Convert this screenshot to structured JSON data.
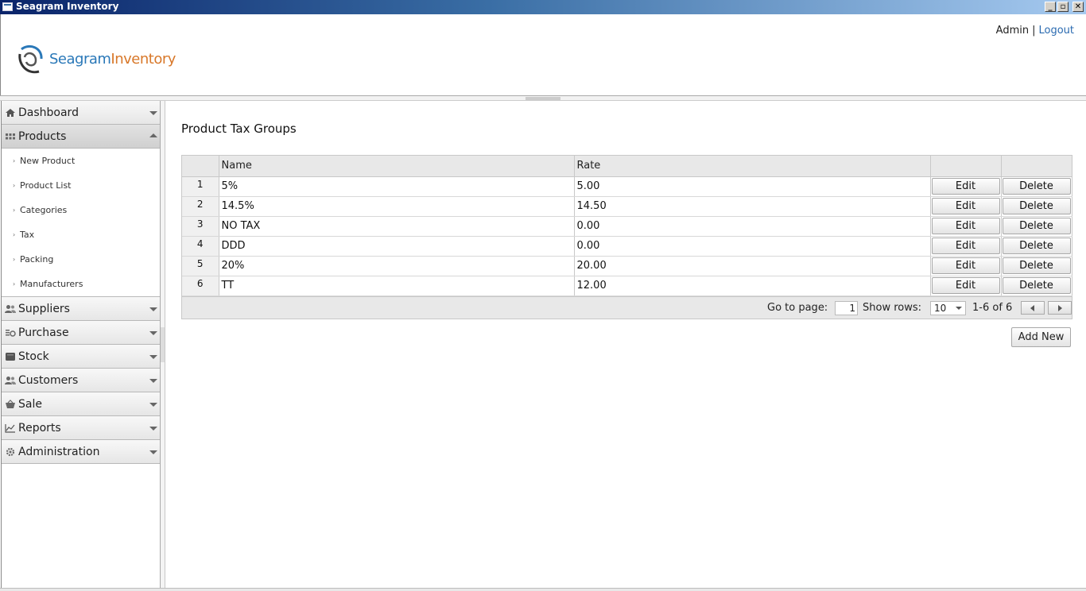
{
  "window": {
    "title": "Seagram Inventory",
    "buttons": [
      "minimize",
      "restore",
      "close"
    ]
  },
  "header": {
    "logo": {
      "part1": "Seagram",
      "part2": "Inventory"
    },
    "user": "Admin",
    "separator": "|",
    "logout": "Logout"
  },
  "sidebar": {
    "items": [
      {
        "label": "Dashboard",
        "icon": "home-icon",
        "expanded": false
      },
      {
        "label": "Products",
        "icon": "grid-icon",
        "expanded": true,
        "children": [
          "New Product",
          "Product List",
          "Categories",
          "Tax",
          "Packing",
          "Manufacturers"
        ]
      },
      {
        "label": "Suppliers",
        "icon": "users-icon",
        "expanded": false
      },
      {
        "label": "Purchase",
        "icon": "purchase-icon",
        "expanded": false
      },
      {
        "label": "Stock",
        "icon": "box-icon",
        "expanded": false
      },
      {
        "label": "Customers",
        "icon": "users-icon",
        "expanded": false
      },
      {
        "label": "Sale",
        "icon": "basket-icon",
        "expanded": false
      },
      {
        "label": "Reports",
        "icon": "chart-icon",
        "expanded": false
      },
      {
        "label": "Administration",
        "icon": "gear-icon",
        "expanded": false
      }
    ],
    "bullet": "›"
  },
  "main": {
    "title": "Product Tax Groups",
    "table": {
      "columns": [
        "",
        "Name",
        "Rate",
        "",
        ""
      ],
      "rows": [
        {
          "n": "1",
          "name": "5%",
          "rate": "5.00"
        },
        {
          "n": "2",
          "name": "14.5%",
          "rate": "14.50"
        },
        {
          "n": "3",
          "name": "NO TAX",
          "rate": "0.00"
        },
        {
          "n": "4",
          "name": "DDD",
          "rate": "0.00"
        },
        {
          "n": "5",
          "name": "20%",
          "rate": "20.00"
        },
        {
          "n": "6",
          "name": "TT",
          "rate": "12.00"
        }
      ],
      "edit_label": "Edit",
      "delete_label": "Delete"
    },
    "pager": {
      "go_to_page_label": "Go to page:",
      "page": "1",
      "show_rows_label": "Show rows:",
      "rows_per_page": "10",
      "range": "1-6 of 6"
    },
    "add_new_label": "Add New"
  }
}
